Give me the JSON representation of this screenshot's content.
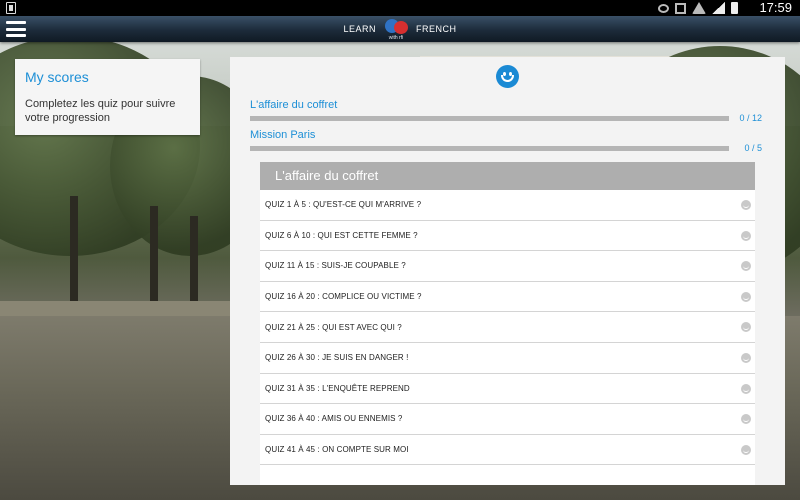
{
  "statusbar": {
    "time": "17:59",
    "icons": [
      "eye-icon",
      "nfc-icon",
      "wifi-icon",
      "signal-icon",
      "battery-icon"
    ]
  },
  "actionbar": {
    "brand_left": "LEARN",
    "brand_right": "FRENCH",
    "brand_tagline": "with rfi"
  },
  "scores": {
    "title": "My scores",
    "text": "Completez les quiz pour suivre votre progression"
  },
  "progress": [
    {
      "label": "L'affaire du coffret",
      "count": "0 / 12",
      "fraction": 0
    },
    {
      "label": "Mission Paris",
      "count": "0 / 5",
      "fraction": 0
    }
  ],
  "quiz_section": {
    "title": "L'affaire du coffret",
    "items": [
      "QUIZ  1 À 5 : QU'EST-CE QUI M'ARRIVE ?",
      "QUIZ  6 À 10 : QUI EST CETTE FEMME ?",
      "QUIZ  11 À 15 : SUIS-JE COUPABLE ?",
      "QUIZ  16 À 20 : COMPLICE OU VICTIME ?",
      "QUIZ  21 À 25 : QUI EST AVEC QUI ?",
      "QUIZ  26 À 30 : JE SUIS EN DANGER !",
      "QUIZ  31 À 35 : L'ENQUÊTE REPREND",
      "QUIZ  36 À 40 : AMIS OU ENNEMIS ?",
      "QUIZ  41 À 45 : ON COMPTE SUR MOI"
    ]
  },
  "colors": {
    "accent": "#1d8fd6",
    "header_gray": "#aeaeae"
  }
}
